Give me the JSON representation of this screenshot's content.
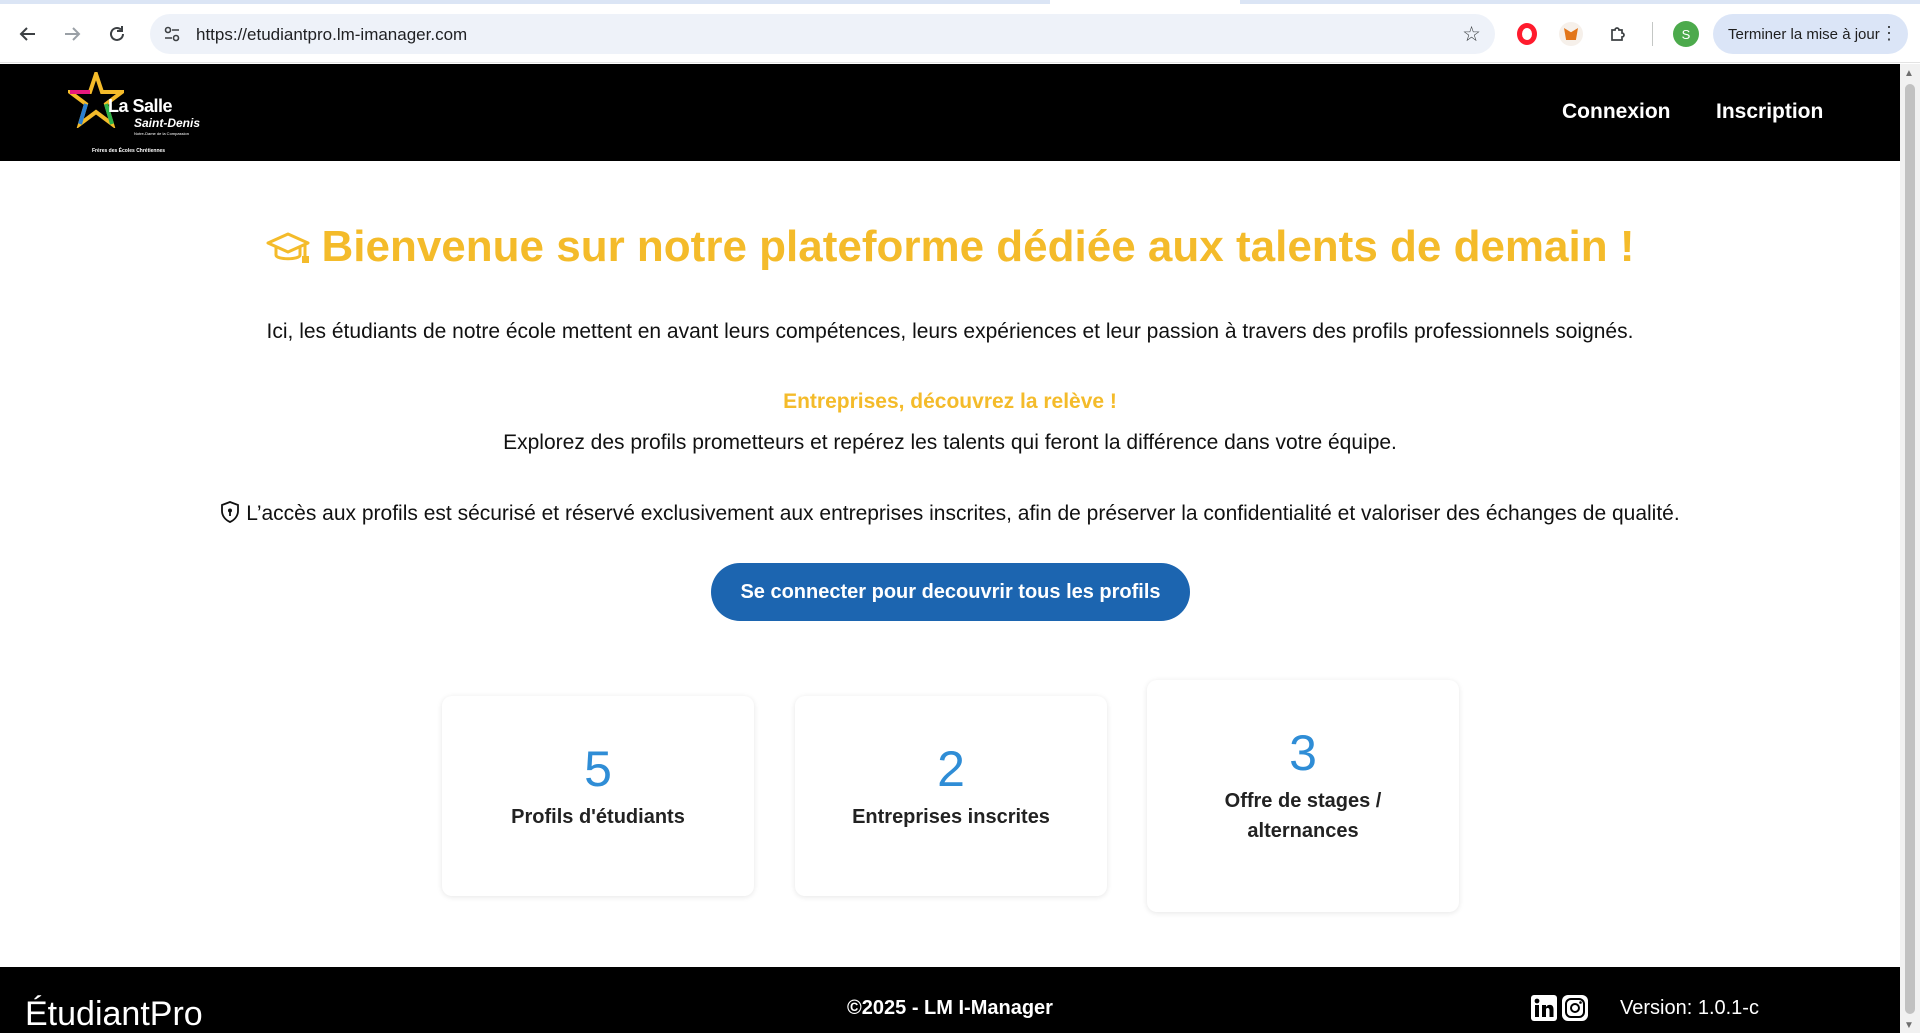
{
  "browser": {
    "url": "https://etudiantpro.lm-imanager.com",
    "profile_initial": "S",
    "update_label": "Terminer la mise à jour"
  },
  "header": {
    "logo": {
      "name": "La Salle",
      "sub": "Saint-Denis",
      "tagline": "Notre-Dame de la Compassion",
      "footer": "Frères des Écoles Chrétiennes"
    },
    "nav": {
      "login": "Connexion",
      "register": "Inscription"
    }
  },
  "hero": {
    "title": "Bienvenue sur notre plateforme dédiée aux talents de demain !",
    "intro": "Ici, les étudiants de notre école mettent en avant leurs compétences, leurs expériences et leur passion à travers des profils professionnels soignés.",
    "subheading": "Entreprises, découvrez la relève !",
    "explore": "Explorez des profils prometteurs et repérez les talents qui feront la différence dans votre équipe.",
    "security": "L’accès aux profils est sécurisé et réservé exclusivement aux entreprises inscrites, afin de préserver la confidentialité et valoriser des échanges de qualité.",
    "cta": "Se connecter pour decouvrir tous les profils"
  },
  "stats": [
    {
      "value": "5",
      "label": "Profils d'étudiants"
    },
    {
      "value": "2",
      "label": "Entreprises inscrites"
    },
    {
      "value": "3",
      "label": "Offre de stages / alternances"
    }
  ],
  "footer": {
    "brand": "ÉtudiantPro",
    "copyright": "©2025 - LM I-Manager",
    "version": "Version: 1.0.1-c"
  },
  "colors": {
    "accent_yellow": "#f4bb2a",
    "button_blue": "#1c65b0",
    "stat_blue": "#2f8dd6",
    "header_bg": "#000000"
  },
  "icons": {
    "title_icon": "graduation-cap-icon",
    "security_icon": "shield-icon",
    "social": [
      "linkedin-icon",
      "instagram-icon"
    ]
  }
}
